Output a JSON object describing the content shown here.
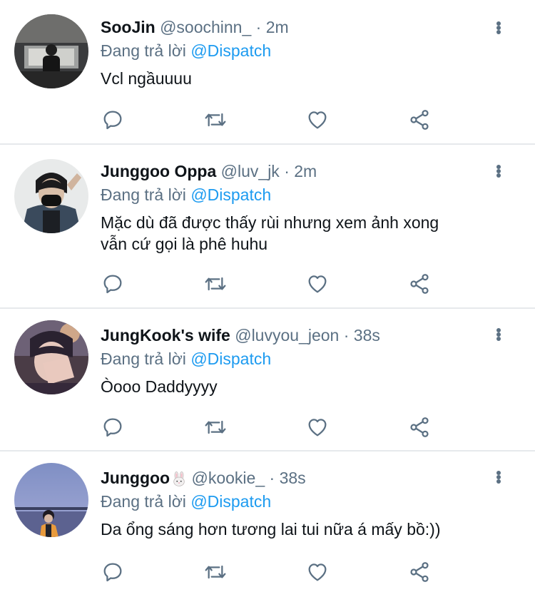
{
  "replying_label": "Đang trả lời",
  "tweets": [
    {
      "name": "SooJin",
      "handle": "@soochinn_",
      "separator": "·",
      "time": "2m",
      "mention": "@Dispatch",
      "lines": [
        "Vcl ngầuuuu"
      ]
    },
    {
      "name": "Junggoo Oppa",
      "handle": "@luv_jk",
      "separator": "·",
      "time": "2m",
      "mention": "@Dispatch",
      "lines": [
        "Mặc dù đã được thấy rùi nhưng xem ảnh xong",
        "vẫn cứ gọi là phê huhu"
      ]
    },
    {
      "name": "JungKook's wife",
      "handle": "@luvyou_jeon",
      "separator": "·",
      "time": "38s",
      "mention": "@Dispatch",
      "lines": [
        "Òooo Daddyyyy"
      ]
    },
    {
      "name": "Junggoo",
      "name_emoji": "rabbit-face-emoji",
      "handle": "@kookie_",
      "separator": "·",
      "time": "38s",
      "mention": "@Dispatch",
      "lines": [
        "Da ổng sáng hơn tương lai tui nữa á mấy bồ:))"
      ]
    }
  ],
  "icons": {
    "reply": "comment-bubble-icon",
    "retweet": "retweet-icon",
    "like": "heart-icon",
    "share": "share-icon",
    "more": "more-vertical-icon"
  },
  "colors": {
    "text": "#0f1419",
    "secondary": "#5b7083",
    "mention": "#1d9bf0",
    "divider": "#e6e9ec"
  }
}
